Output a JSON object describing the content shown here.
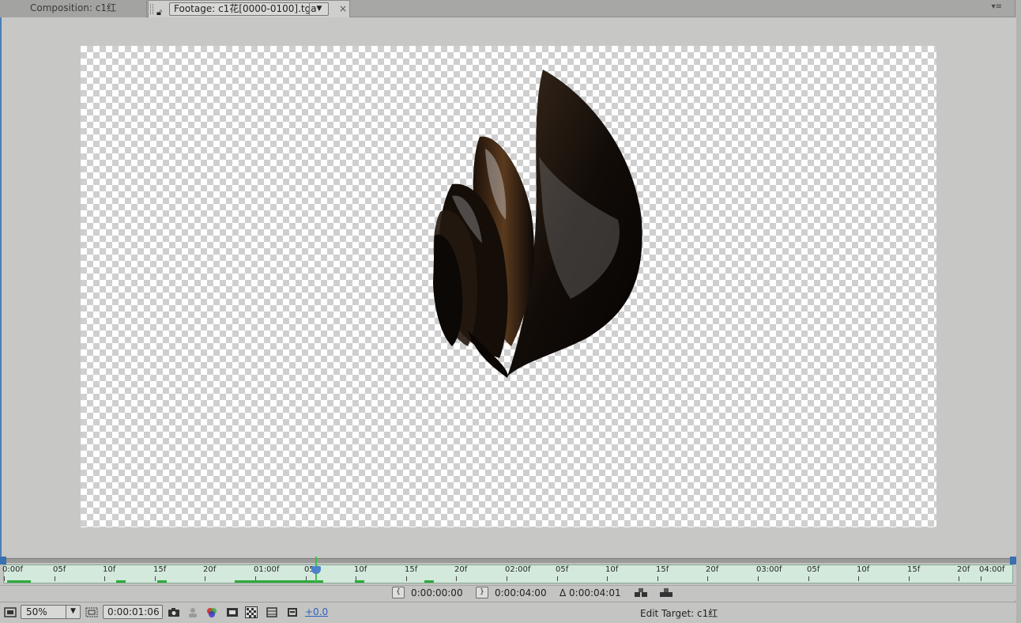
{
  "tabs": {
    "composition_label": "Composition: c1红",
    "footage_label": "Footage: c1花[0000-0100].tga",
    "close_symbol": "×",
    "menu_symbol": "▾≡"
  },
  "timeline": {
    "ruler_ticks": [
      "0:00f",
      "05f",
      "10f",
      "15f",
      "20f",
      "01:00f",
      "05f",
      "10f",
      "15f",
      "20f",
      "02:00f",
      "05f",
      "10f",
      "15f",
      "20f",
      "03:00f",
      "05f",
      "10f",
      "15f",
      "20f",
      "04:00f"
    ],
    "current_frame_fraction": 0.31
  },
  "time_info": {
    "in_point": "0:00:00:00",
    "out_point": "0:00:04:00",
    "duration": "Δ 0:00:04:01"
  },
  "toolbar": {
    "zoom": "50%",
    "current_time": "0:00:01:06",
    "exposure": "+0.0",
    "edit_target": "Edit Target: c1红"
  },
  "colors": {
    "accent_blue": "#4e82c8",
    "cache_green": "#2eaa3c",
    "ruler_bg": "#d3e9dc"
  }
}
